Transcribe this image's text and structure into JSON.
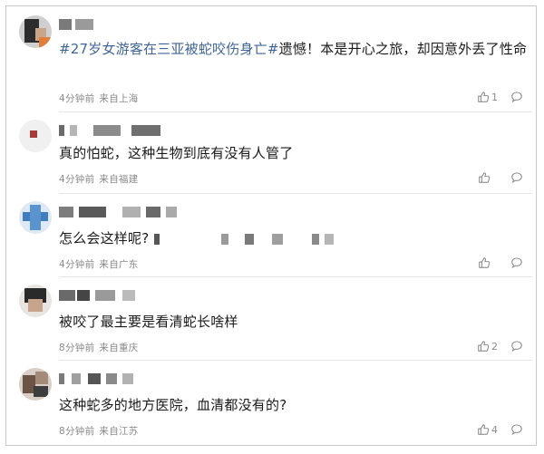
{
  "colors": {
    "hashtag": "#406599",
    "text": "#1a1a1a",
    "meta": "#8a8a8a",
    "divider": "#e6e6e6",
    "border": "#c9c9c9"
  },
  "icons": {
    "like": "thumbs-up-icon",
    "reply": "comment-bubble-icon"
  },
  "comments": [
    {
      "hashtag": "#27岁女游客在三亚被蛇咬伤身亡#",
      "text": "遗憾！本是开心之旅，却因意外丢了性命",
      "time": "4分钟前",
      "source": "来自上海",
      "likes": "1"
    },
    {
      "text": "真的怕蛇，这种生物到底有没有人管了",
      "time": "4分钟前",
      "source": "来自福建",
      "likes": ""
    },
    {
      "text": "怎么会这样呢?",
      "time": "4分钟前",
      "source": "来自广东",
      "likes": ""
    },
    {
      "text": "被咬了最主要是看清蛇长啥样",
      "time": "8分钟前",
      "source": "来自重庆",
      "likes": "2"
    },
    {
      "text": "这种蛇多的地方医院，血清都没有的?",
      "time": "8分钟前",
      "source": "来自江苏",
      "likes": "4"
    }
  ]
}
